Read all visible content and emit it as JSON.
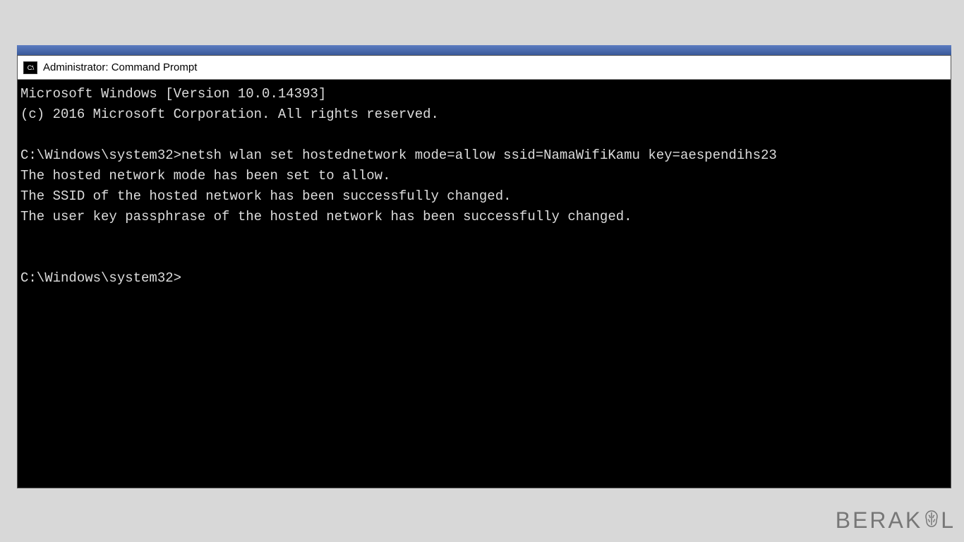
{
  "window": {
    "icon_label": "C:\\",
    "title": "Administrator: Command Prompt"
  },
  "console": {
    "banner_line1": "Microsoft Windows [Version 10.0.14393]",
    "banner_line2": "(c) 2016 Microsoft Corporation. All rights reserved.",
    "prompt1": "C:\\Windows\\system32>",
    "command1": "netsh wlan set hostednetwork mode=allow ssid=NamaWifiKamu key=aespendihs23",
    "output_line1": "The hosted network mode has been set to allow.",
    "output_line2": "The SSID of the hosted network has been successfully changed.",
    "output_line3": "The user key passphrase of the hosted network has been successfully changed.",
    "prompt2": "C:\\Windows\\system32>"
  },
  "watermark": {
    "text_before": "BERAK",
    "text_after": "L"
  }
}
